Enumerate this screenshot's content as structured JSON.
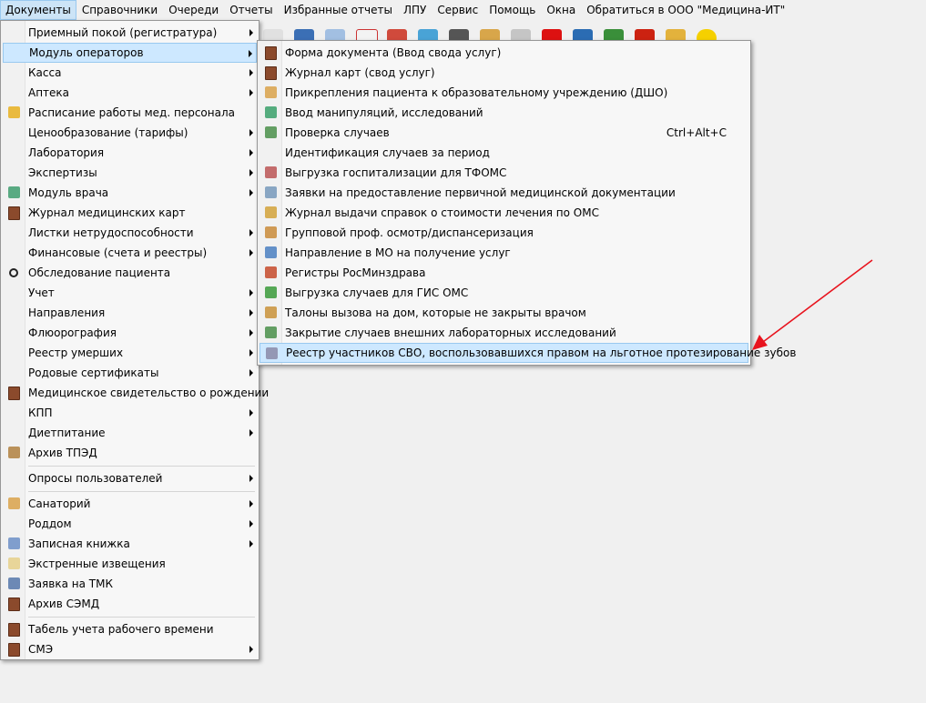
{
  "menubar": [
    "Документы",
    "Справочники",
    "Очереди",
    "Отчеты",
    "Избранные отчеты",
    "ЛПУ",
    "Сервис",
    "Помощь",
    "Окна",
    "Обратиться в ООО \"Медицина-ИТ\""
  ],
  "main_menu": [
    {
      "label": "Приемный покой (регистратура)",
      "sub": true,
      "icon": ""
    },
    {
      "label": "Модуль операторов",
      "sub": true,
      "icon": "",
      "highlight": true
    },
    {
      "label": "Касса",
      "sub": true,
      "icon": ""
    },
    {
      "label": "Аптека",
      "sub": true,
      "icon": ""
    },
    {
      "label": "Расписание работы мед. персонала",
      "sub": false,
      "icon": "schedule-icon"
    },
    {
      "label": "Ценообразование (тарифы)",
      "sub": true,
      "icon": ""
    },
    {
      "label": "Лаборатория",
      "sub": true,
      "icon": ""
    },
    {
      "label": "Экспертизы",
      "sub": true,
      "icon": ""
    },
    {
      "label": "Модуль врача",
      "sub": true,
      "icon": "doctor-icon"
    },
    {
      "label": "Журнал медицинских карт",
      "sub": false,
      "icon": "book-icon"
    },
    {
      "label": "Листки нетрудоспособности",
      "sub": true,
      "icon": ""
    },
    {
      "label": "Финансовые (счета и реестры)",
      "sub": true,
      "icon": ""
    },
    {
      "label": "Обследование пациента",
      "sub": false,
      "icon": "magnifier-icon"
    },
    {
      "label": "Учет",
      "sub": true,
      "icon": ""
    },
    {
      "label": "Направления",
      "sub": true,
      "icon": ""
    },
    {
      "label": "Флюорография",
      "sub": true,
      "icon": ""
    },
    {
      "label": "Реестр умерших",
      "sub": true,
      "icon": ""
    },
    {
      "label": "Родовые сертификаты",
      "sub": true,
      "icon": ""
    },
    {
      "label": "Медицинское свидетельство о рождении",
      "sub": false,
      "icon": "book-icon"
    },
    {
      "label": "КПП",
      "sub": true,
      "icon": ""
    },
    {
      "label": "Диетпитание",
      "sub": true,
      "icon": ""
    },
    {
      "label": "Архив ТПЭД",
      "sub": false,
      "icon": "archive-icon",
      "sep_after": true
    },
    {
      "label": "Опросы пользователей",
      "sub": true,
      "icon": "",
      "sep_after": true
    },
    {
      "label": "Санаторий",
      "sub": true,
      "icon": "house-icon"
    },
    {
      "label": "Роддом",
      "sub": true,
      "icon": ""
    },
    {
      "label": "Записная книжка",
      "sub": true,
      "icon": "notebook-icon"
    },
    {
      "label": "Экстренные извещения",
      "sub": false,
      "icon": "envelope-icon"
    },
    {
      "label": "Заявка на ТМК",
      "sub": false,
      "icon": "user-computer-icon"
    },
    {
      "label": "Архив СЭМД",
      "sub": false,
      "icon": "book-icon",
      "sep_after": true
    },
    {
      "label": "Табель учета рабочего времени",
      "sub": false,
      "icon": "book-icon"
    },
    {
      "label": "СМЭ",
      "sub": true,
      "icon": "book-icon"
    }
  ],
  "sub_menu": [
    {
      "label": "Форма документа (Ввод свода услуг)",
      "icon": "book-icon",
      "shortcut": ""
    },
    {
      "label": "Журнал карт (свод услуг)",
      "icon": "book-icon",
      "shortcut": ""
    },
    {
      "label": "Прикрепления пациента к образовательному учреждению (ДШО)",
      "icon": "house-icon",
      "shortcut": ""
    },
    {
      "label": "Ввод манипуляций, исследований",
      "icon": "flask-icon",
      "shortcut": ""
    },
    {
      "label": "Проверка случаев",
      "icon": "checklist-icon",
      "shortcut": "Ctrl+Alt+C"
    },
    {
      "label": "Идентификация случаев за период",
      "icon": "",
      "shortcut": ""
    },
    {
      "label": "Выгрузка госпитализации для ТФОМС",
      "icon": "gear-icon",
      "shortcut": ""
    },
    {
      "label": "Заявки на предоставление первичной медицинской документации",
      "icon": "document-icon",
      "shortcut": ""
    },
    {
      "label": "Журнал выдачи справок о стоимости лечения по ОМС",
      "icon": "coins-icon",
      "shortcut": ""
    },
    {
      "label": "Групповой проф. осмотр/диспансеризация",
      "icon": "group-icon",
      "shortcut": ""
    },
    {
      "label": "Направление в МО на получение услуг",
      "icon": "hospital-icon",
      "shortcut": ""
    },
    {
      "label": "Регистры РосМинздрава",
      "icon": "chart-icon",
      "shortcut": ""
    },
    {
      "label": "Выгрузка случаев для ГИС ОМС",
      "icon": "download-icon",
      "shortcut": ""
    },
    {
      "label": "Талоны вызова на дом, которые не закрыты врачом",
      "icon": "user-add-icon",
      "shortcut": ""
    },
    {
      "label": "Закрытие случаев внешних лабораторных исследований",
      "icon": "checklist-icon",
      "shortcut": ""
    },
    {
      "label": "Реестр участников СВО, воспользовавшихся правом на льготное протезирование зубов",
      "icon": "user-list-icon",
      "shortcut": "",
      "highlight": true
    }
  ],
  "colors": {
    "annotation_arrow": "#e8141e",
    "highlight": "#cde8ff"
  }
}
